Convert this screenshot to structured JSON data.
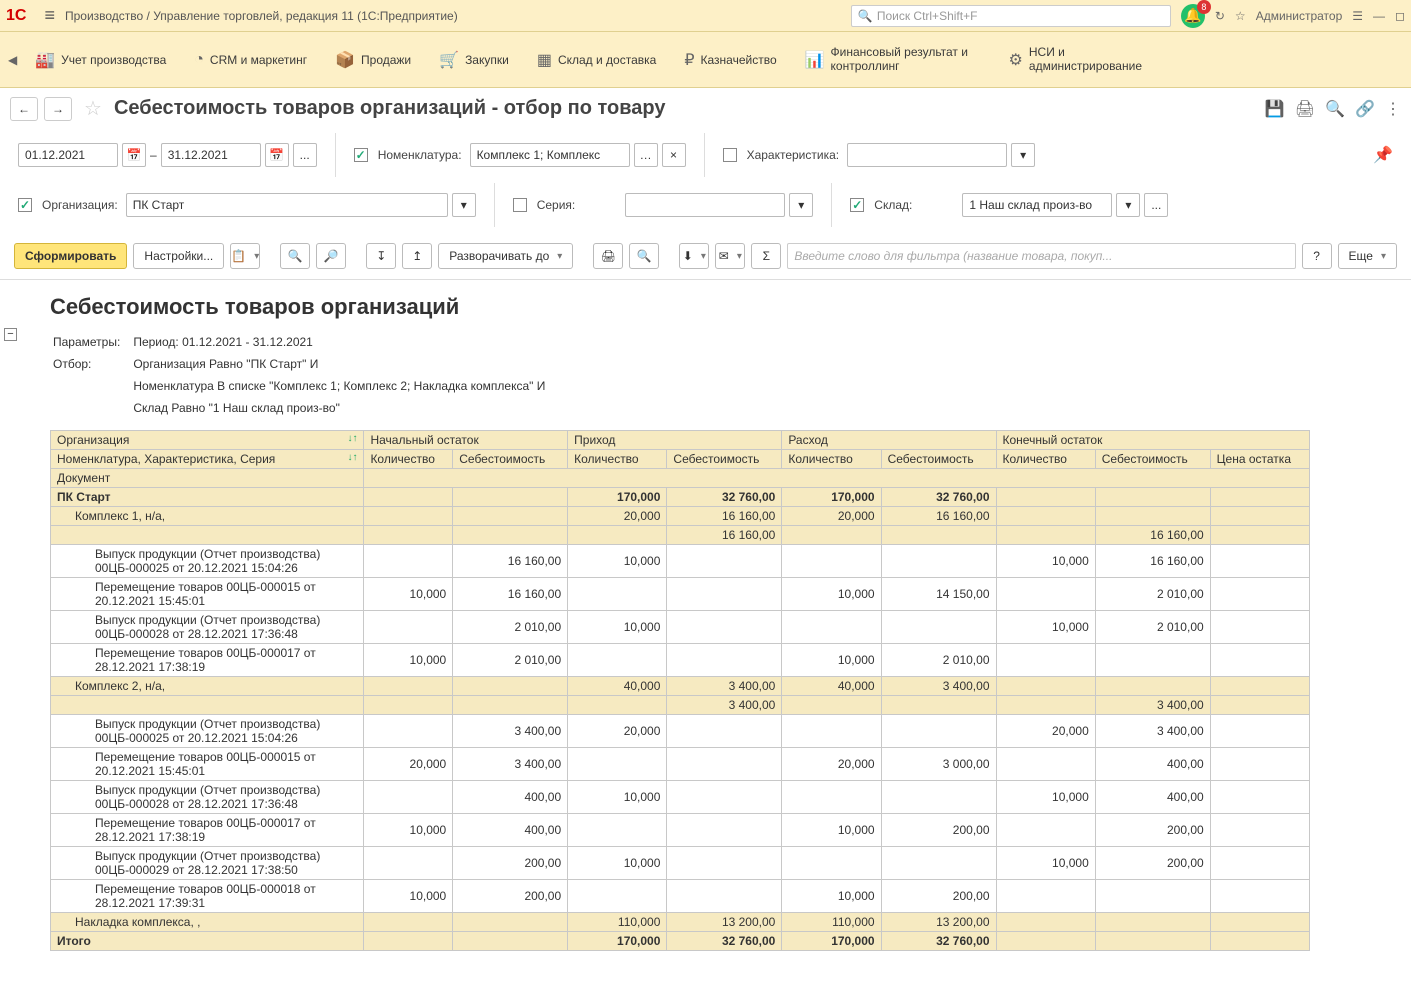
{
  "titlebar": {
    "app_title": "Производство / Управление торговлей, редакция 11  (1С:Предприятие)",
    "search_placeholder": "Поиск Ctrl+Shift+F",
    "notif_count": "8",
    "user_label": "Администратор"
  },
  "sections": [
    "Учет производства",
    "CRM и маркетинг",
    "Продажи",
    "Закупки",
    "Склад и доставка",
    "Казначейство",
    "Финансовый результат и контроллинг",
    "НСИ и администрирование"
  ],
  "page": {
    "title": "Себестоимость товаров организаций - отбор по товару"
  },
  "filters": {
    "date_from": "01.12.2021",
    "date_to": "31.12.2021",
    "dash": "–",
    "more": "...",
    "org_label": "Организация:",
    "org_value": "ПК Старт",
    "nom_label": "Номенклатура:",
    "nom_value": "Комплекс 1; Комплекс",
    "nom_clear": "×",
    "char_label": "Характеристика:",
    "ser_label": "Серия:",
    "sklad_label": "Склад:",
    "sklad_value": "1 Наш склад произ-во",
    "sklad_more": "..."
  },
  "toolbar": {
    "form": "Сформировать",
    "settings": "Настройки...",
    "expand": "Разворачивать до",
    "filter_placeholder": "Введите слово для фильтра (название товара, покуп...",
    "more": "Еще",
    "help": "?"
  },
  "report": {
    "title": "Себестоимость товаров организаций",
    "param_label": "Параметры:",
    "param_period": "Период: 01.12.2021 - 31.12.2021",
    "filter_label": "Отбор:",
    "filter_line1": "Организация Равно \"ПК Старт\" И",
    "filter_line2": "Номенклатура В списке \"Комплекс 1; Комплекс 2; Накладка комплекса\" И",
    "filter_line3": "Склад Равно \"1 Наш склад произ-во\"",
    "headers": {
      "org": "Организация",
      "nom": "Номенклатура, Характеристика, Серия",
      "doc": "Документ",
      "start": "Начальный остаток",
      "prih": "Приход",
      "rash": "Расход",
      "end": "Конечный остаток",
      "qty": "Количество",
      "cost": "Себестоимость",
      "price": "Цена остатка"
    },
    "rows": [
      {
        "type": "org",
        "label": "ПК Старт",
        "pq": "170,000",
        "pc": "32 760,00",
        "rq": "170,000",
        "rc": "32 760,00"
      },
      {
        "type": "nom",
        "label": "Комплекс 1, н/а,",
        "pq": "20,000",
        "pc": "16 160,00",
        "rq": "20,000",
        "rc": "16 160,00"
      },
      {
        "type": "blank",
        "pc": "16 160,00",
        "ec": "16 160,00"
      },
      {
        "type": "doc",
        "label": "Выпуск продукции (Отчет производства) 00ЦБ-000025 от 20.12.2021 15:04:26",
        "sc": "16 160,00",
        "pq": "10,000",
        "eq": "10,000",
        "ec": "16 160,00"
      },
      {
        "type": "doc",
        "label": "Перемещение товаров 00ЦБ-000015 от 20.12.2021 15:45:01",
        "sq": "10,000",
        "sc": "16 160,00",
        "rq": "10,000",
        "rc": "14 150,00",
        "ec": "2 010,00"
      },
      {
        "type": "doc",
        "label": "Выпуск продукции (Отчет производства) 00ЦБ-000028 от 28.12.2021 17:36:48",
        "sc": "2 010,00",
        "pq": "10,000",
        "eq": "10,000",
        "ec": "2 010,00"
      },
      {
        "type": "doc",
        "label": "Перемещение товаров 00ЦБ-000017 от 28.12.2021 17:38:19",
        "sq": "10,000",
        "sc": "2 010,00",
        "rq": "10,000",
        "rc": "2 010,00"
      },
      {
        "type": "nom",
        "label": "Комплекс 2, н/а,",
        "pq": "40,000",
        "pc": "3 400,00",
        "rq": "40,000",
        "rc": "3 400,00"
      },
      {
        "type": "blank",
        "pc": "3 400,00",
        "ec": "3 400,00"
      },
      {
        "type": "doc",
        "label": "Выпуск продукции (Отчет производства) 00ЦБ-000025 от 20.12.2021 15:04:26",
        "sc": "3 400,00",
        "pq": "20,000",
        "eq": "20,000",
        "ec": "3 400,00"
      },
      {
        "type": "doc",
        "label": "Перемещение товаров 00ЦБ-000015 от 20.12.2021 15:45:01",
        "sq": "20,000",
        "sc": "3 400,00",
        "rq": "20,000",
        "rc": "3 000,00",
        "ec": "400,00"
      },
      {
        "type": "doc",
        "label": "Выпуск продукции (Отчет производства) 00ЦБ-000028 от 28.12.2021 17:36:48",
        "sc": "400,00",
        "pq": "10,000",
        "eq": "10,000",
        "ec": "400,00"
      },
      {
        "type": "doc",
        "label": "Перемещение товаров 00ЦБ-000017 от 28.12.2021 17:38:19",
        "sq": "10,000",
        "sc": "400,00",
        "rq": "10,000",
        "rc": "200,00",
        "ec": "200,00"
      },
      {
        "type": "doc",
        "label": "Выпуск продукции (Отчет производства) 00ЦБ-000029 от 28.12.2021 17:38:50",
        "sc": "200,00",
        "pq": "10,000",
        "eq": "10,000",
        "ec": "200,00"
      },
      {
        "type": "doc",
        "label": "Перемещение товаров 00ЦБ-000018 от 28.12.2021 17:39:31",
        "sq": "10,000",
        "sc": "200,00",
        "rq": "10,000",
        "rc": "200,00"
      },
      {
        "type": "nom-collapsed",
        "label": "Накладка комплекса, ,",
        "pq": "110,000",
        "pc": "13 200,00",
        "rq": "110,000",
        "rc": "13 200,00"
      },
      {
        "type": "total",
        "label": "Итого",
        "pq": "170,000",
        "pc": "32 760,00",
        "rq": "170,000",
        "rc": "32 760,00"
      }
    ]
  }
}
